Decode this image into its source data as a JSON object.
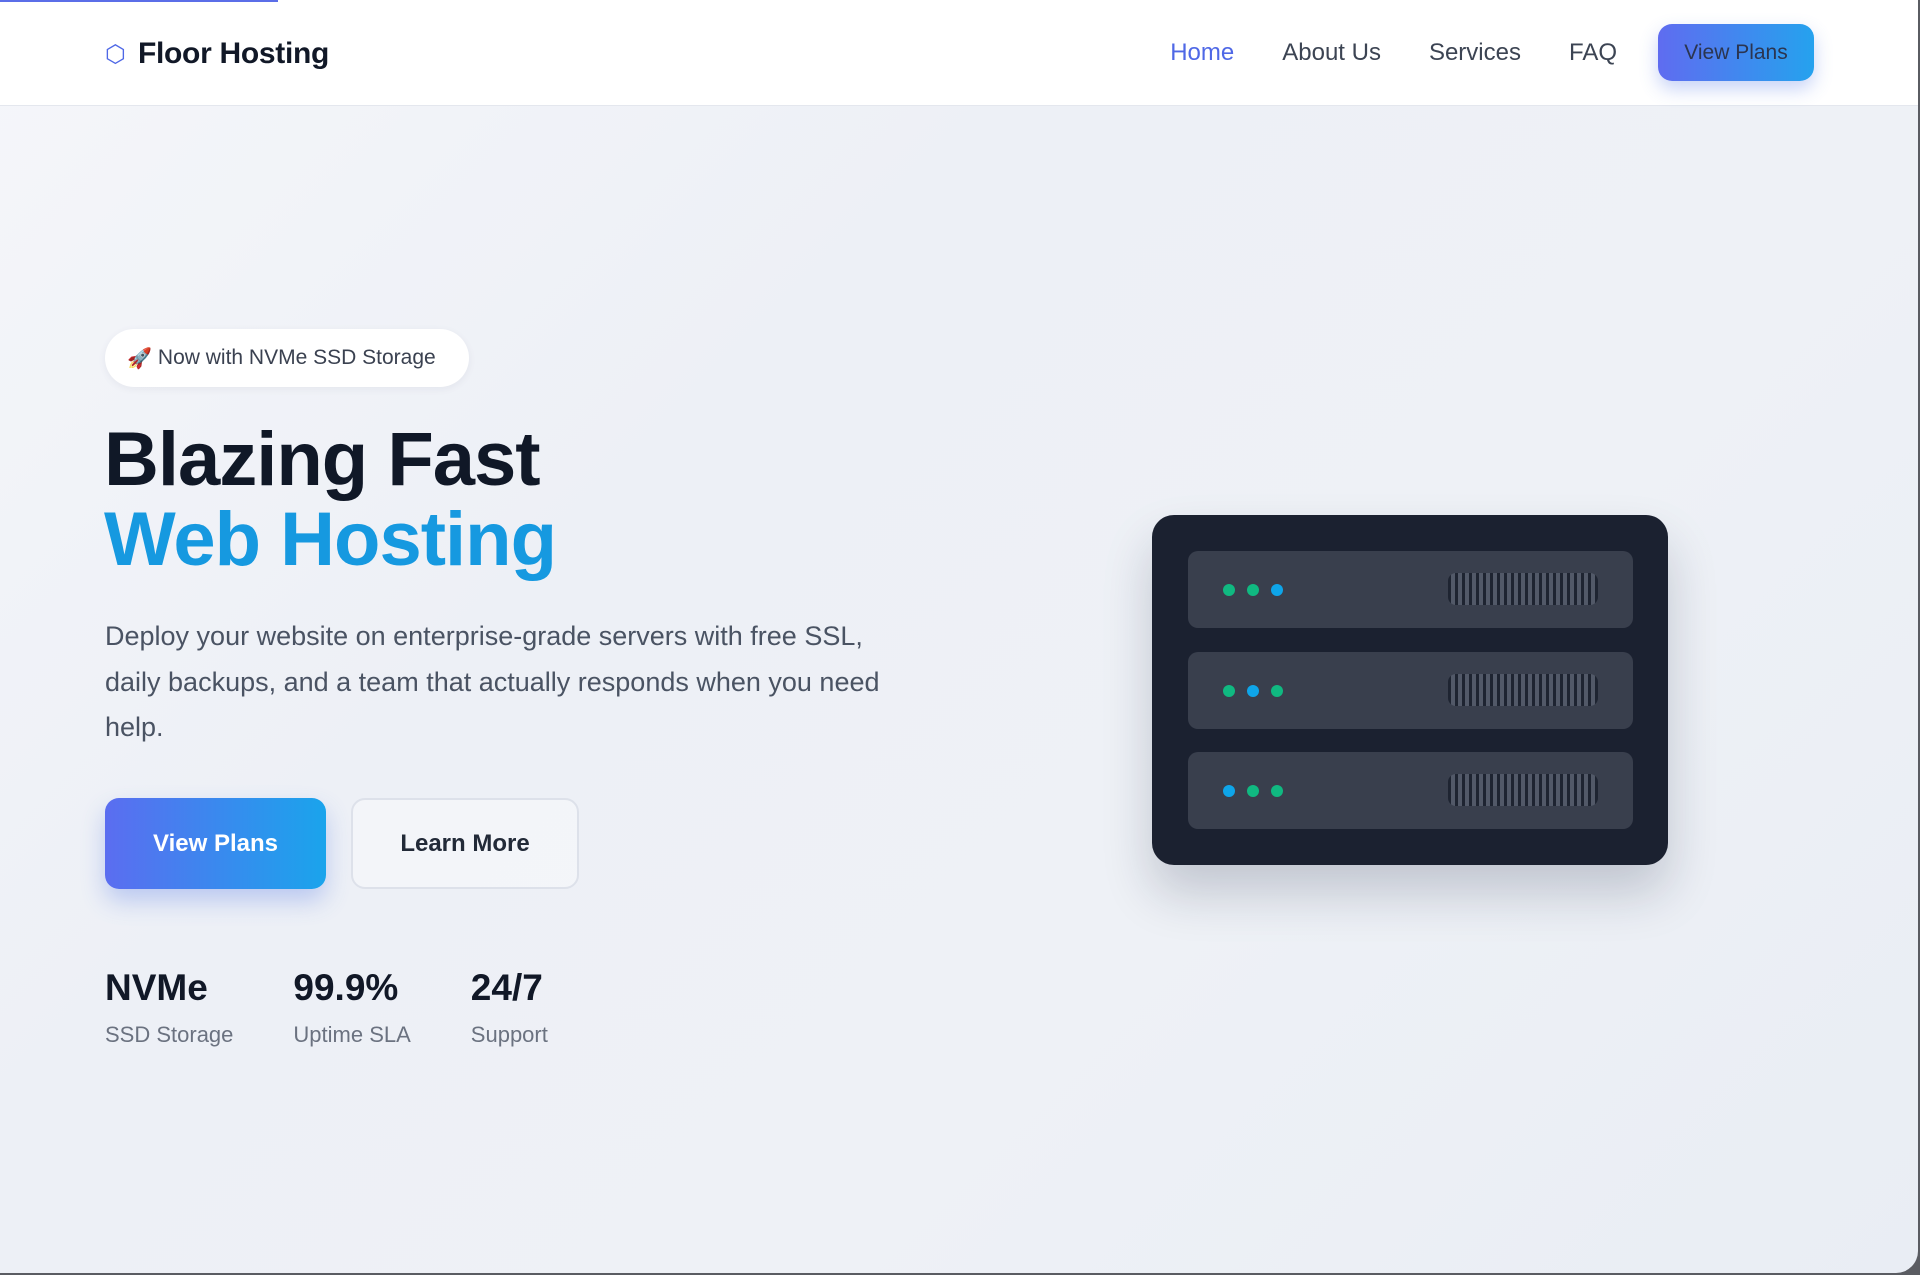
{
  "header": {
    "logo_icon": "hexagon-icon",
    "logo_glyph": "⬡",
    "brand": "Floor Hosting",
    "nav": [
      {
        "label": "Home",
        "active": true
      },
      {
        "label": "About Us",
        "active": false
      },
      {
        "label": "Services",
        "active": false
      },
      {
        "label": "FAQ",
        "active": false
      }
    ],
    "cta_label": "View Plans"
  },
  "hero": {
    "badge_icon": "rocket-icon",
    "badge_glyph": "🚀",
    "badge_text": "Now with NVMe SSD Storage",
    "title_line1": "Blazing Fast",
    "title_line2": "Web Hosting",
    "description": "Deploy your website on enterprise-grade servers with free SSL, daily backups, and a team that actually responds when you need help.",
    "primary_button": "View Plans",
    "secondary_button": "Learn More",
    "stats": [
      {
        "value": "NVMe",
        "label": "SSD Storage"
      },
      {
        "value": "99.9%",
        "label": "Uptime SLA"
      },
      {
        "value": "24/7",
        "label": "Support"
      }
    ]
  },
  "server_illustration": {
    "units": [
      {
        "leds": [
          "#10b981",
          "#10b981",
          "#0ea5e9"
        ]
      },
      {
        "leds": [
          "#10b981",
          "#0ea5e9",
          "#10b981"
        ]
      },
      {
        "leds": [
          "#0ea5e9",
          "#10b981",
          "#10b981"
        ]
      }
    ]
  },
  "colors": {
    "accent": "#4f68e6",
    "accent_cyan": "#1699e0",
    "text_dark": "#101827",
    "server_body": "#1b2130",
    "server_unit": "#393f4d"
  }
}
